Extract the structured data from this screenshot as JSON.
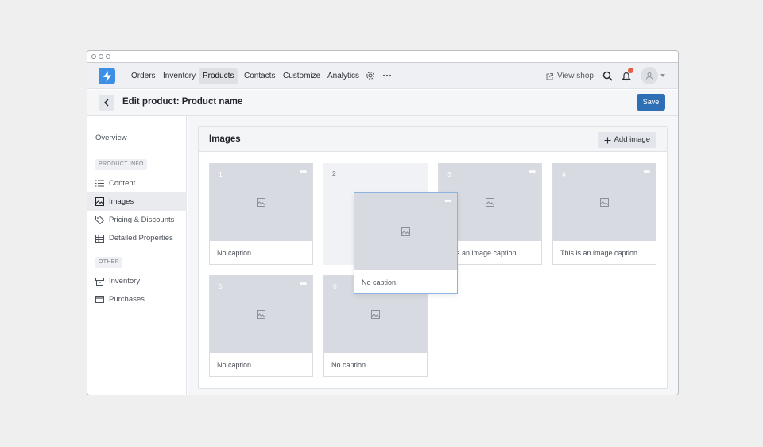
{
  "nav": {
    "items": [
      "Orders",
      "Inventory",
      "Products",
      "Contacts",
      "Customize",
      "Analytics"
    ],
    "active": "Products",
    "view_shop": "View shop",
    "notification_count": ""
  },
  "subheader": {
    "title": "Edit product: Product name",
    "save_label": "Save"
  },
  "sidebar": {
    "overview": "Overview",
    "section1": "PRODUCT INFO",
    "content": "Content",
    "images": "Images",
    "pricing": "Pricing & Discounts",
    "detailed": "Detailed Properties",
    "section2": "OTHER",
    "inventory": "Inventory",
    "purchases": "Purchases"
  },
  "panel": {
    "title": "Images",
    "add_label": "Add image"
  },
  "cards": [
    {
      "num": "1",
      "caption": "No caption."
    },
    {
      "num": "2",
      "caption": ""
    },
    {
      "num": "3",
      "caption": "s is an image caption."
    },
    {
      "num": "4",
      "caption": "This is an image caption."
    },
    {
      "num": "5",
      "caption": "No caption."
    },
    {
      "num": "6",
      "caption": "No caption."
    }
  ],
  "dragging_card": {
    "caption": "No caption."
  },
  "colors": {
    "accent": "#2f6fb5",
    "logo": "#3d8fe6",
    "badge": "#e85c45"
  }
}
